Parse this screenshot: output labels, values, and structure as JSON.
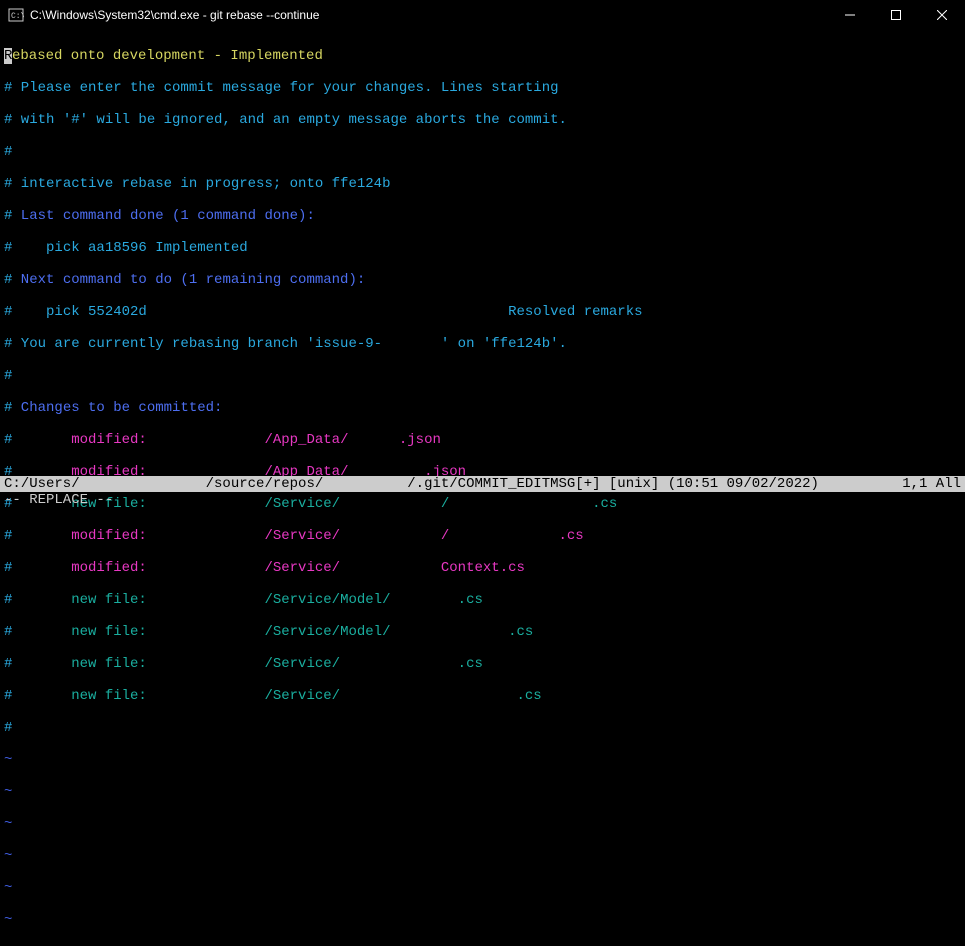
{
  "titlebar": {
    "title": "C:\\Windows\\System32\\cmd.exe - git  rebase --continue"
  },
  "lines": {
    "l1": "Rebased onto development - Implemented",
    "l2a": "#",
    "l2b": " Please enter the commit message for your changes. Lines starting",
    "l3a": "#",
    "l3b": " with '#' will be ignored, and an empty message aborts the commit.",
    "l4": "#",
    "l5a": "#",
    "l5b": " interactive rebase in progress; onto ffe124b",
    "l6a": "#",
    "l6b": " Last command done (1 command done):",
    "l7a": "#",
    "l7b": "    pick aa18596 Implemented",
    "l8a": "#",
    "l8b": " Next command to do (1 remaining command):",
    "l9a": "#",
    "l9b": "    pick 552402d                                           Resolved remarks",
    "l10a": "#",
    "l10b": " You are currently rebasing branch 'issue-9-       ' on 'ffe124b'.",
    "l11": "#",
    "l12a": "#",
    "l12b": " Changes to be committed:",
    "f1a": "#       ",
    "f1b": "modified:              /App_Data/      .json",
    "f2a": "#       ",
    "f2b": "modified:              /App_Data/         .json",
    "f3a": "#       ",
    "f3b": "new file:              /Service/            /                 .cs",
    "f4a": "#       ",
    "f4b": "modified:              /Service/            /             .cs",
    "f5a": "#       ",
    "f5b": "modified:              /Service/            Context.cs",
    "f6a": "#       ",
    "f6b": "new file:              /Service/Model/        .cs",
    "f7a": "#       ",
    "f7b": "new file:              /Service/Model/              .cs",
    "f8a": "#       ",
    "f8b": "new file:              /Service/              .cs",
    "f9a": "#       ",
    "f9b": "new file:              /Service/                     .cs",
    "lend": "#"
  },
  "tilde": "~",
  "status": {
    "left": "C:/Users/               /source/repos/          /.git/COMMIT_EDITMSG[+] [unix] (10:51 09/02/2022)",
    "right": "1,1 All"
  },
  "mode": "-- REPLACE --"
}
